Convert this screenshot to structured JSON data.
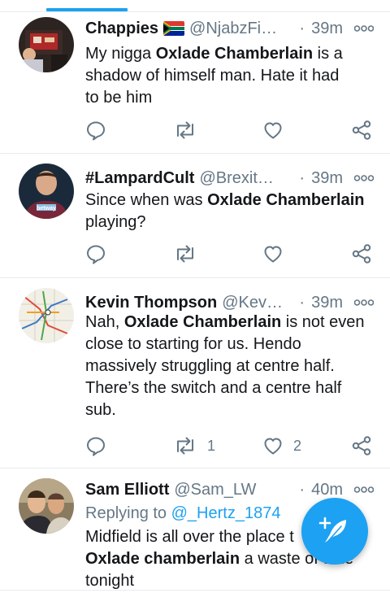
{
  "colors": {
    "accent": "#1da1f2",
    "text": "#14171a",
    "muted": "#657786",
    "divider": "#e6ecf0"
  },
  "tweets": [
    {
      "name": "Chappies",
      "flag_icon": "south-africa-flag-icon",
      "handle": "@NjabzFi…",
      "separator": "·",
      "time": "39m",
      "lines": [
        [
          {
            "t": "My nigga "
          },
          {
            "t": "Oxlade Chamberlain",
            "b": true
          },
          {
            "t": " is a"
          }
        ],
        [
          {
            "t": "shadow of himself man. Hate it had"
          }
        ],
        [
          {
            "t": "to be him"
          }
        ]
      ],
      "retweets": "",
      "likes": ""
    },
    {
      "name": "#LampardCult",
      "handle": "@Brexit…",
      "separator": "·",
      "time": "39m",
      "lines": [
        [
          {
            "t": "Since when was "
          },
          {
            "t": "Oxlade Chamberlain",
            "b": true
          }
        ],
        [
          {
            "t": "playing?"
          }
        ]
      ],
      "avatar_text": "betway",
      "retweets": "",
      "likes": ""
    },
    {
      "name": "Kevin Thompson",
      "handle": "@Kev…",
      "separator": "·",
      "time": "39m",
      "lines": [
        [
          {
            "t": "Nah, "
          },
          {
            "t": "Oxlade Chamberlain",
            "b": true
          },
          {
            "t": " is not even"
          }
        ],
        [
          {
            "t": "close to starting for us. Hendo"
          }
        ],
        [
          {
            "t": "massively struggling at centre half."
          }
        ],
        [
          {
            "t": "There’s the switch and a centre half"
          }
        ],
        [
          {
            "t": "sub."
          }
        ]
      ],
      "retweets": "1",
      "likes": "2"
    },
    {
      "name": "Sam Elliott",
      "handle": "@Sam_LW",
      "separator": "·",
      "time": "40m",
      "reply_prefix": "Replying to",
      "reply_mention": "@_Hertz_1874",
      "lines": [
        [
          {
            "t": "Midfield is all over the place t"
          }
        ],
        [
          {
            "t": "Oxlade chamberlain",
            "b": true
          },
          {
            "t": " a waste of time"
          }
        ],
        [
          {
            "t": "tonight"
          }
        ]
      ]
    }
  ],
  "compose_button": {
    "icon": "compose-tweet-feather-plus-icon"
  }
}
